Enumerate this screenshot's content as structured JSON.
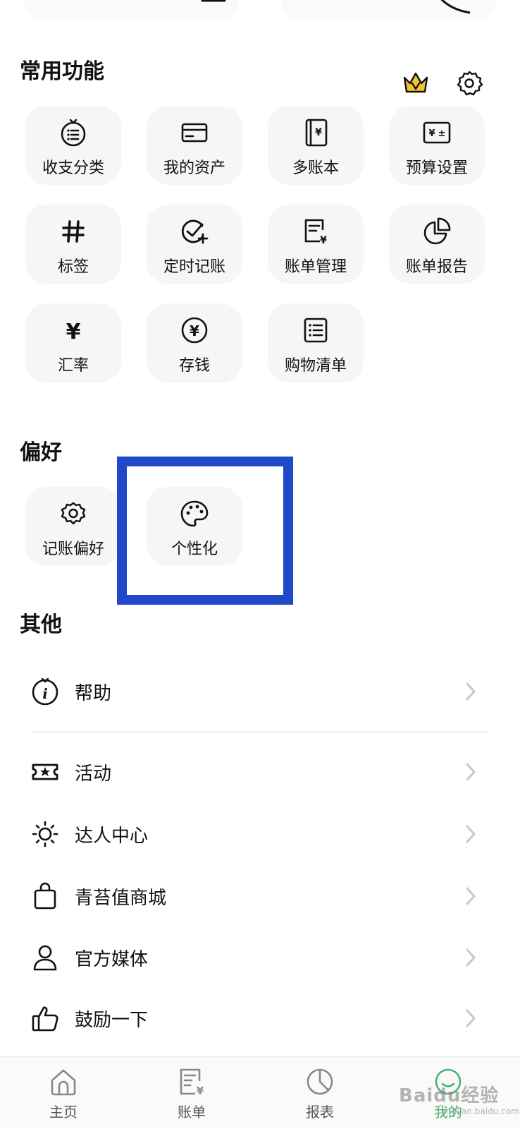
{
  "common": {
    "title": "常用功能",
    "items": [
      {
        "label": "收支分类",
        "icon": "category-list-icon"
      },
      {
        "label": "我的资产",
        "icon": "card-icon"
      },
      {
        "label": "多账本",
        "icon": "ledger-book-icon"
      },
      {
        "label": "预算设置",
        "icon": "budget-icon"
      },
      {
        "label": "标签",
        "icon": "hashtag-icon"
      },
      {
        "label": "定时记账",
        "icon": "scheduled-check-icon"
      },
      {
        "label": "账单管理",
        "icon": "bill-manage-icon"
      },
      {
        "label": "账单报告",
        "icon": "pie-report-icon"
      },
      {
        "label": "汇率",
        "icon": "yen-icon"
      },
      {
        "label": "存钱",
        "icon": "yen-coin-icon"
      },
      {
        "label": "购物清单",
        "icon": "shopping-list-icon"
      }
    ]
  },
  "preference": {
    "title": "偏好",
    "items": [
      {
        "label": "记账偏好",
        "icon": "gear-flower-icon"
      },
      {
        "label": "个性化",
        "icon": "palette-icon"
      }
    ]
  },
  "other": {
    "title": "其他",
    "items": [
      {
        "label": "帮助",
        "icon": "info-icon"
      },
      {
        "label": "活动",
        "icon": "ticket-icon"
      },
      {
        "label": "达人中心",
        "icon": "sun-icon"
      },
      {
        "label": "青苔值商城",
        "icon": "shopping-bag-icon"
      },
      {
        "label": "官方媒体",
        "icon": "person-icon"
      },
      {
        "label": "鼓励一下",
        "icon": "thumbs-up-icon"
      }
    ]
  },
  "tabbar": {
    "items": [
      {
        "label": "主页",
        "icon": "home-icon"
      },
      {
        "label": "账单",
        "icon": "bill-icon"
      },
      {
        "label": "报表",
        "icon": "chart-icon"
      },
      {
        "label": "我的",
        "icon": "profile-icon"
      }
    ]
  },
  "watermark": {
    "text": "Baidu经验",
    "sub": "jingyan.baidu.com"
  },
  "colors": {
    "accent_highlight": "#1f49c9",
    "active_tab": "#4fb36e",
    "crown": "#f2c230",
    "tile_bg": "#f6f6f6"
  }
}
